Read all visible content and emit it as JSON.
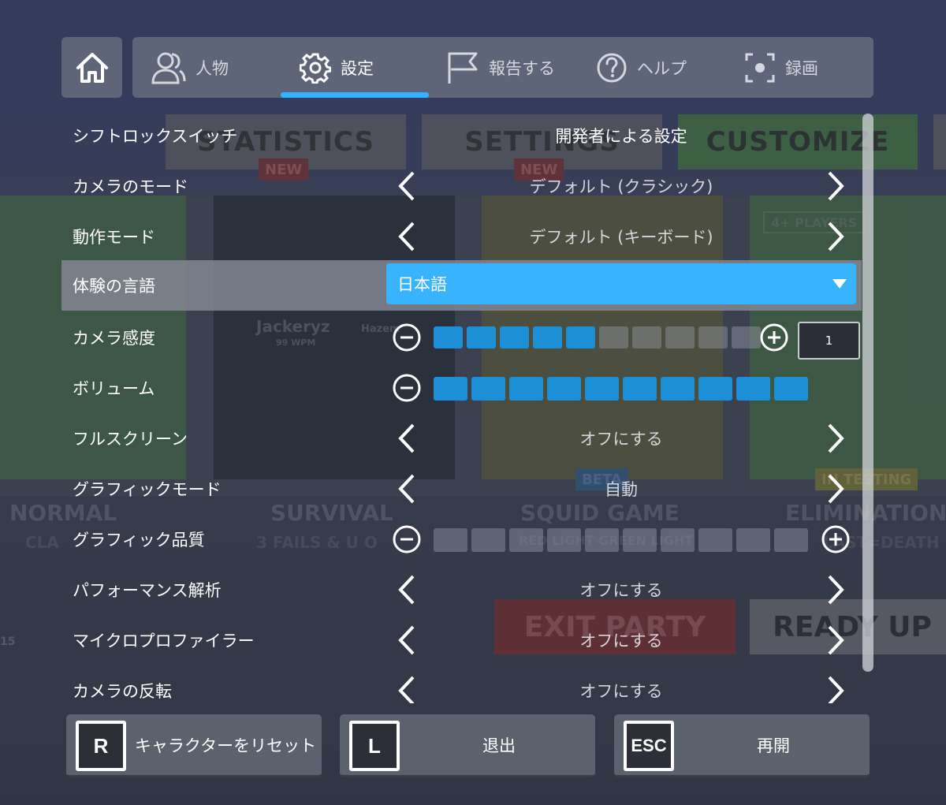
{
  "tabs": [
    {
      "label": "人物",
      "icon": "people-icon"
    },
    {
      "label": "設定",
      "icon": "gear-icon"
    },
    {
      "label": "報告する",
      "icon": "flag-icon"
    },
    {
      "label": "ヘルプ",
      "icon": "help-icon"
    },
    {
      "label": "録画",
      "icon": "record-icon"
    }
  ],
  "active_tab": "設定",
  "settings": {
    "shift_lock": {
      "label": "シフトロックスイッチ",
      "value": "開発者による設定"
    },
    "camera_mode": {
      "label": "カメラのモード",
      "value": "デフォルト (クラシック)"
    },
    "movement_mode": {
      "label": "動作モード",
      "value": "デフォルト (キーボード)"
    },
    "experience_language": {
      "label": "体験の言語",
      "value": "日本語"
    },
    "camera_sensitivity": {
      "label": "カメラ感度",
      "level": 5,
      "max": 10,
      "value": "1"
    },
    "volume": {
      "label": "ボリューム",
      "level": 10,
      "max": 10
    },
    "fullscreen": {
      "label": "フルスクリーン",
      "value": "オフにする"
    },
    "graphics_mode": {
      "label": "グラフィックモード",
      "value": "自動"
    },
    "graphics_quality": {
      "label": "グラフィック品質",
      "level": 0,
      "max": 10
    },
    "performance_stats": {
      "label": "パフォーマンス解析",
      "value": "オフにする"
    },
    "micro_profiler": {
      "label": "マイクロプロファイラー",
      "value": "オフにする"
    },
    "camera_inverted": {
      "label": "カメラの反転",
      "value": "オフにする"
    }
  },
  "buttons": {
    "reset": {
      "key": "R",
      "label": "キャラクターをリセット"
    },
    "leave": {
      "key": "L",
      "label": "退出"
    },
    "resume": {
      "key": "ESC",
      "label": "再開"
    }
  },
  "background": {
    "signs": [
      "STATISTICS",
      "SETTINGS",
      "CUSTOMIZE"
    ],
    "badges": [
      "NEW",
      "NEW",
      "BETA",
      "IN TESTING",
      "4+ PLAYERS"
    ],
    "modes": [
      "NORMAL",
      "SURVIVAL",
      "SQUID GAME",
      "ELIMINATION"
    ],
    "mode_subtitles": [
      "CLA",
      "3 FAILS & U O",
      "RED LIGHT GREEN LIGHT",
      "LAST=DEATH"
    ],
    "board_player": "Jackeryz",
    "board_wpm": "99 WPM",
    "board_player2": "Hazem",
    "party_buttons": [
      "EXIT PARTY",
      "READY UP"
    ],
    "side_count": "15"
  },
  "colors": {
    "accent": "#38b4ff",
    "slider_on": "#1c8fd6",
    "underline": "#33b3ff"
  }
}
